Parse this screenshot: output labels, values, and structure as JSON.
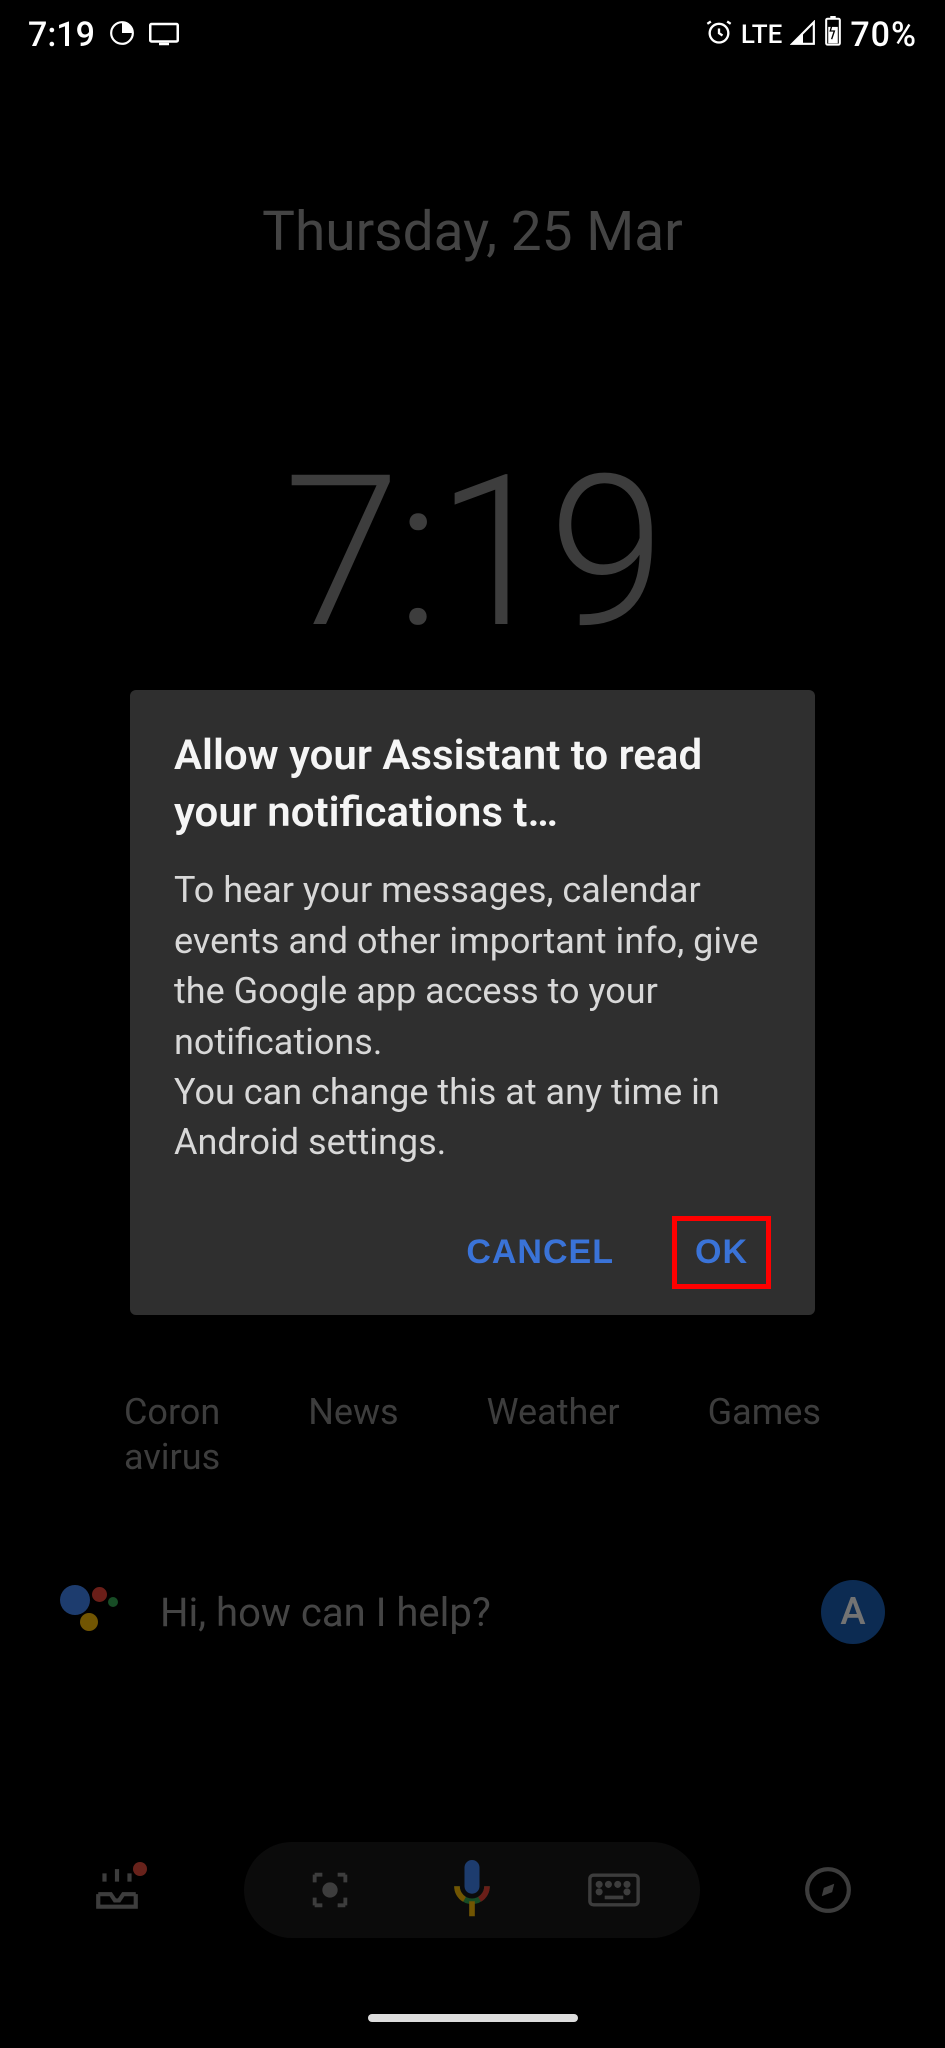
{
  "status": {
    "time": "7:19",
    "network": "LTE",
    "battery": "70%"
  },
  "home": {
    "date": "Thursday, 25 Mar",
    "clock": "7:19"
  },
  "dialog": {
    "title": "Allow your Assistant to read your notifications t…",
    "body": "To hear your messages, calendar events and other important info, give the Google app access to your notifications.\nYou can change this at any time in Android settings.",
    "cancel_label": "CANCEL",
    "ok_label": "OK"
  },
  "chips": {
    "items": [
      "Coron\navirus",
      "News",
      "Weather",
      "Games"
    ]
  },
  "assistant": {
    "prompt": "Hi, how can I help?",
    "avatar_initial": "A"
  }
}
